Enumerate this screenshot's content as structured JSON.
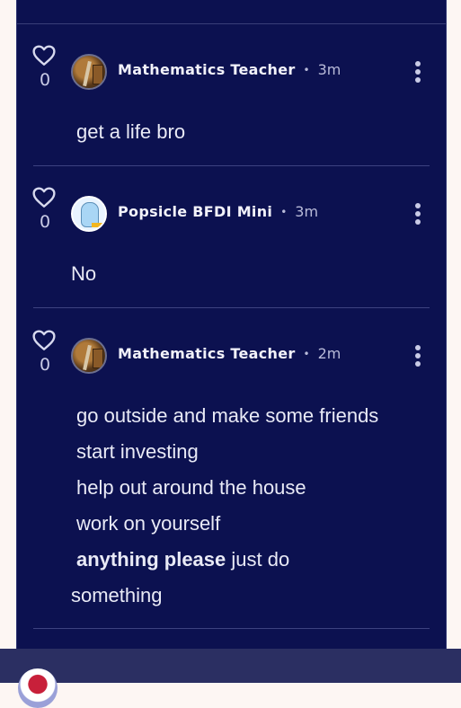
{
  "comments": [
    {
      "likes": "0",
      "author": "Mathematics Teacher",
      "separator": "•",
      "time": "3m",
      "lines": [
        "get a life bro"
      ]
    },
    {
      "likes": "0",
      "author": "Popsicle BFDI Mini",
      "separator": "•",
      "time": "3m",
      "lines": [
        "No"
      ]
    },
    {
      "likes": "0",
      "author": "Mathematics Teacher",
      "separator": "•",
      "time": "2m",
      "lines": [
        "go outside and make some friends",
        "start investing",
        "help out around the house",
        "work on yourself"
      ],
      "bold": "anything please",
      "after_bold": " just do",
      "last_line": "something"
    }
  ],
  "icons": {
    "like": "heart-outline-icon",
    "more": "vertical-ellipsis-icon"
  },
  "colors": {
    "panel": "#0c1150",
    "page": "#fdf6f3",
    "bottom_bar": "#2b2f62"
  }
}
